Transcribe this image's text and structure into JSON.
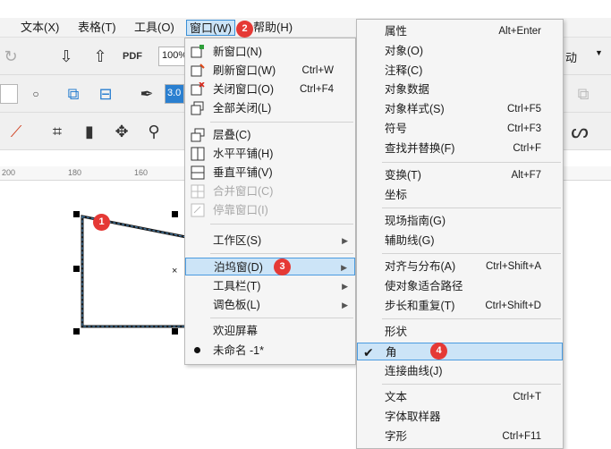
{
  "menubar": {
    "items": [
      {
        "label": "文本(X)"
      },
      {
        "label": "表格(T)"
      },
      {
        "label": "工具(O)"
      },
      {
        "label": "窗口(W)"
      },
      {
        "label": "帮助(H)"
      }
    ]
  },
  "toolbar": {
    "zoom_value": "100%",
    "outline_width_value": "3.0",
    "right_label": "动"
  },
  "ruler": {
    "ticks": [
      "200",
      "180",
      "160"
    ]
  },
  "canvas": {
    "center_mark": "×"
  },
  "badges": [
    "1",
    "2",
    "3",
    "4"
  ],
  "window_menu": {
    "items": [
      {
        "label": "新窗口(N)",
        "icon": "new-window-icon"
      },
      {
        "label": "刷新窗口(W)",
        "shortcut": "Ctrl+W",
        "icon": "refresh-window-icon"
      },
      {
        "label": "关闭窗口(O)",
        "shortcut": "Ctrl+F4",
        "icon": "close-window-icon"
      },
      {
        "label": "全部关闭(L)",
        "icon": "close-all-icon"
      },
      {
        "label": "层叠(C)",
        "icon": "cascade-icon"
      },
      {
        "label": "水平平铺(H)",
        "icon": "tile-horizontal-icon"
      },
      {
        "label": "垂直平铺(V)",
        "icon": "tile-vertical-icon"
      },
      {
        "label": "合并窗口(C)",
        "icon": "merge-windows-icon",
        "disabled": true
      },
      {
        "label": "停靠窗口(I)",
        "icon": "dock-window-icon",
        "disabled": true
      },
      {
        "label": "工作区(S)"
      },
      {
        "label": "泊坞窗(D)"
      },
      {
        "label": "工具栏(T)"
      },
      {
        "label": "调色板(L)"
      },
      {
        "label": "欢迎屏幕"
      },
      {
        "label": "未命名 -1*"
      }
    ]
  },
  "docker_menu": {
    "items": [
      {
        "label": "属性",
        "shortcut": "Alt+Enter"
      },
      {
        "label": "对象(O)"
      },
      {
        "label": "注释(C)"
      },
      {
        "label": "对象数据"
      },
      {
        "label": "对象样式(S)",
        "shortcut": "Ctrl+F5"
      },
      {
        "label": "符号",
        "shortcut": "Ctrl+F3"
      },
      {
        "label": "查找并替换(F)",
        "shortcut": "Ctrl+F"
      },
      {
        "label": "变换(T)",
        "shortcut": "Alt+F7"
      },
      {
        "label": "坐标"
      },
      {
        "label": "现场指南(G)"
      },
      {
        "label": "辅助线(G)"
      },
      {
        "label": "对齐与分布(A)",
        "shortcut": "Ctrl+Shift+A"
      },
      {
        "label": "使对象适合路径"
      },
      {
        "label": "步长和重复(T)",
        "shortcut": "Ctrl+Shift+D"
      },
      {
        "label": "形状"
      },
      {
        "label": "角"
      },
      {
        "label": "连接曲线(J)"
      },
      {
        "label": "文本",
        "shortcut": "Ctrl+T"
      },
      {
        "label": "字体取样器"
      },
      {
        "label": "字形",
        "shortcut": "Ctrl+F11"
      }
    ]
  },
  "colors": {
    "accent": "#3b8fd6",
    "highlight": "#cce4f7",
    "badge": "#e53935"
  }
}
